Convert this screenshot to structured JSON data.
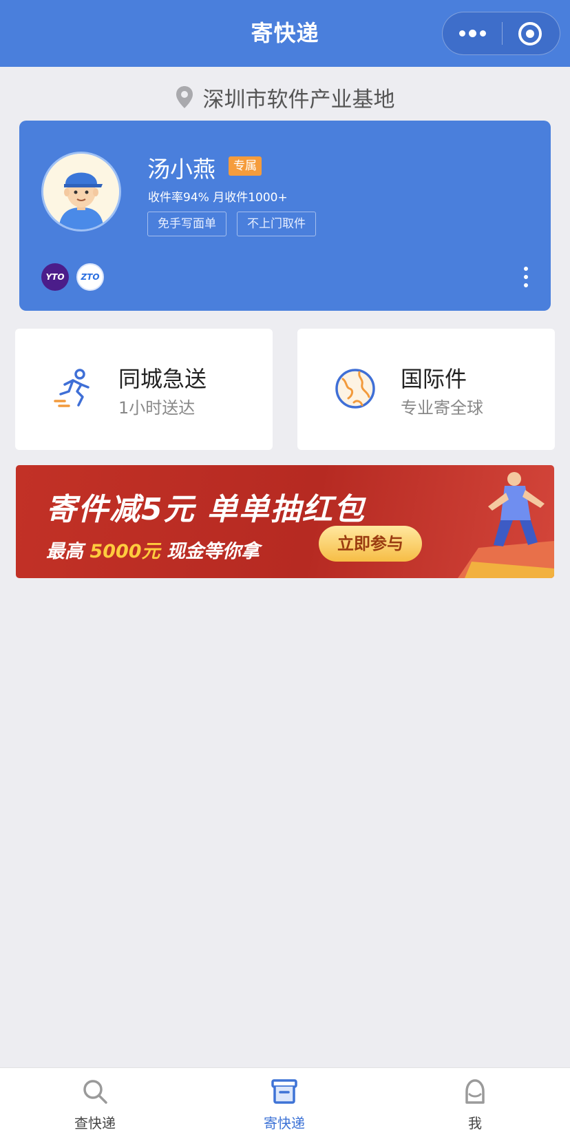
{
  "header": {
    "title": "寄快递",
    "more_icon": "more-dots-icon",
    "close_icon": "close-target-icon",
    "color": "#4a7fdc"
  },
  "location": {
    "icon": "location-pin-icon",
    "text": "深圳市软件产业基地"
  },
  "courier": {
    "name": "汤小燕",
    "badge": "专属",
    "stats": "收件率94%  月收件1000+",
    "tags": [
      "免手写面单",
      "不上门取件"
    ],
    "carriers": [
      {
        "label": "YTO",
        "icon": "yto-logo"
      },
      {
        "label": "ZTO",
        "icon": "zto-logo"
      }
    ],
    "menu_icon": "vertical-dots-icon"
  },
  "services": [
    {
      "title": "同城急送",
      "subtitle": "1小时送达",
      "icon": "running-man-icon"
    },
    {
      "title": "国际件",
      "subtitle": "专业寄全球",
      "icon": "globe-icon"
    }
  ],
  "banner": {
    "title": "寄件减5元  单单抽红包",
    "sub_prefix": "最高",
    "sub_highlight": "5000元",
    "sub_suffix": "现金等你拿",
    "button": "立即参与"
  },
  "tabbar": {
    "items": [
      {
        "label": "查快递",
        "icon": "search-icon",
        "active": false
      },
      {
        "label": "寄快递",
        "icon": "box-icon",
        "active": true
      },
      {
        "label": "我",
        "icon": "user-icon",
        "active": false
      }
    ],
    "active_color": "#3e73d6"
  }
}
